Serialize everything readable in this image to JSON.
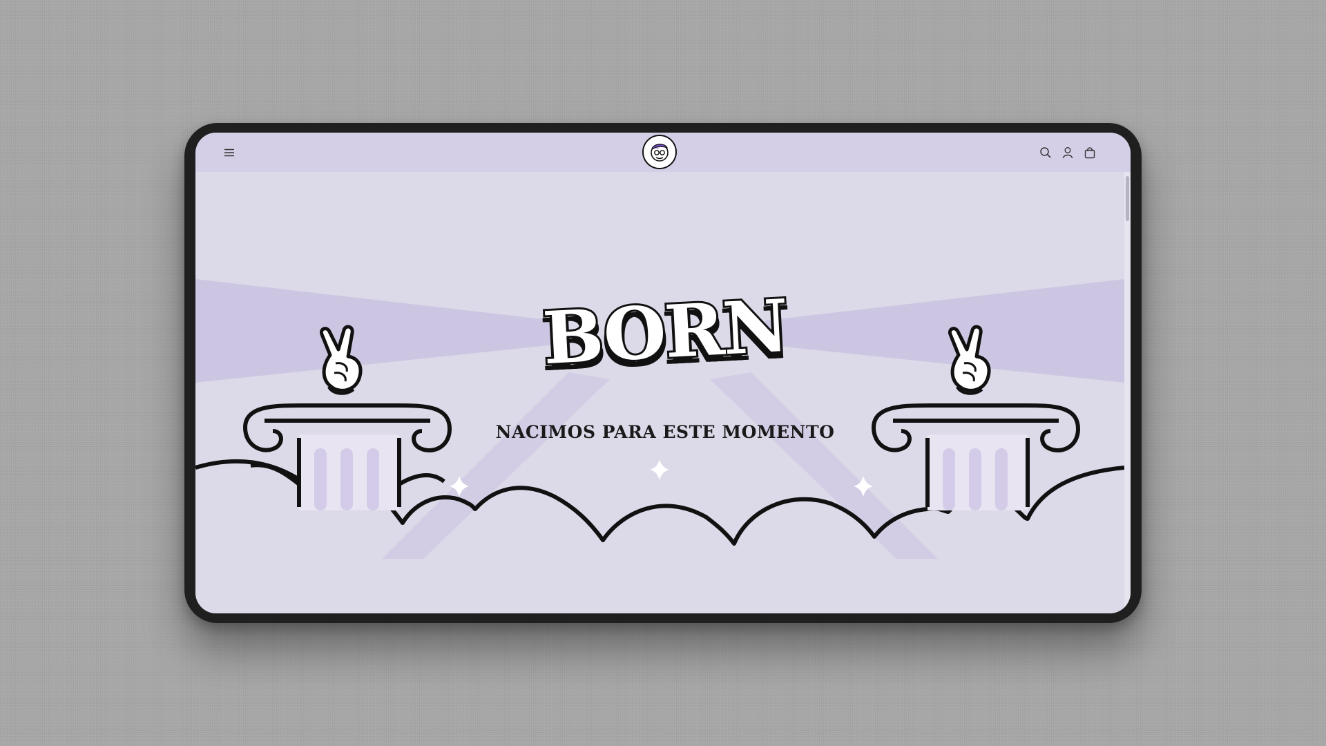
{
  "header": {
    "menu_icon": "hamburger-menu-icon",
    "logo_icon": "mascot-logo-icon",
    "search_icon": "search-icon",
    "account_icon": "user-icon",
    "cart_icon": "shopping-bag-icon"
  },
  "hero": {
    "brand": "BORN",
    "tagline": "NACIMOS PARA ESTE MOMENTO"
  },
  "colors": {
    "page_bg": "#dcdae8",
    "header_bg": "#d4cfe6",
    "accent_purple": "#7b4fd1",
    "ink": "#111111"
  }
}
